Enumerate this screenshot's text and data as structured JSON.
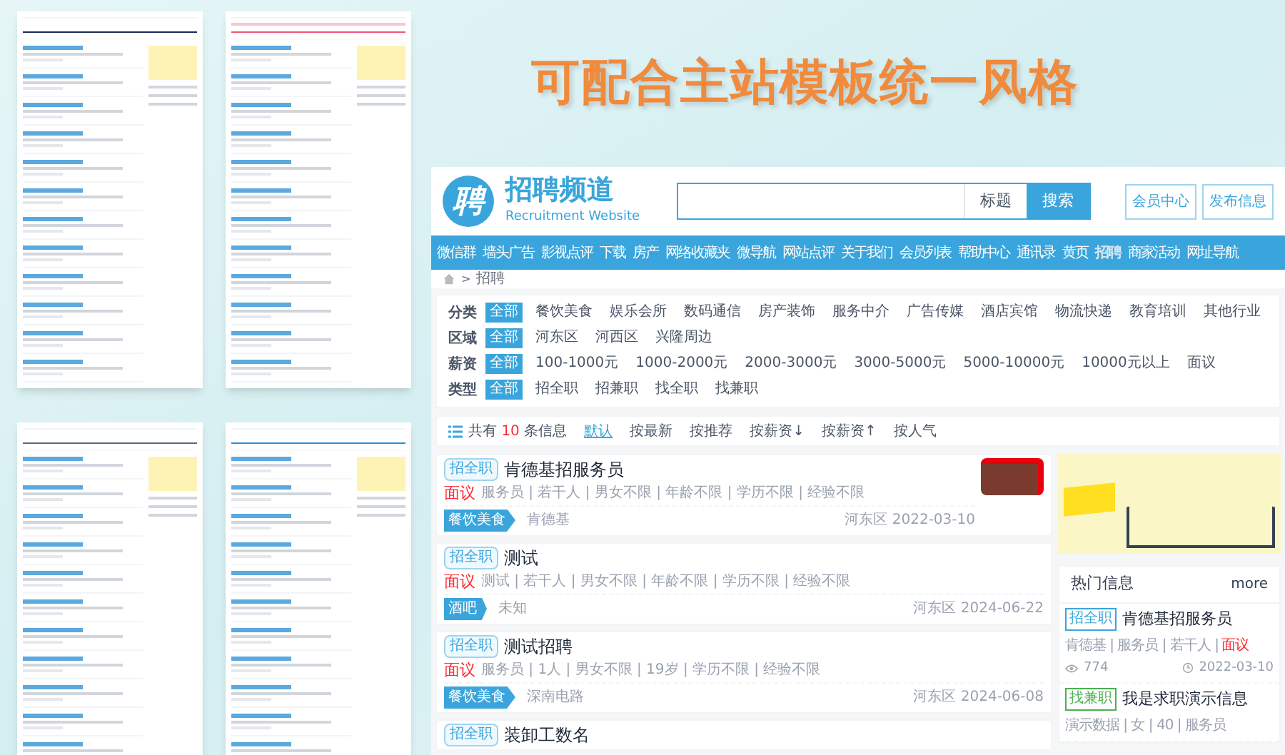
{
  "headline": "可配合主站模板统一风格",
  "site": {
    "logo_char": "聘",
    "title": "招聘频道",
    "subtitle": "Recruitment Website",
    "search": {
      "scope": "标题",
      "button": "搜索"
    },
    "header_buttons": [
      "会员中心",
      "发布信息"
    ]
  },
  "nav": [
    {
      "label": "微信群",
      "selected": false
    },
    {
      "label": "墙头广告",
      "selected": false
    },
    {
      "label": "影视点评",
      "selected": false
    },
    {
      "label": "下载",
      "selected": false
    },
    {
      "label": "房产",
      "selected": false
    },
    {
      "label": "网络收藏夹",
      "selected": false
    },
    {
      "label": "微导航",
      "selected": false
    },
    {
      "label": "网站点评",
      "selected": false
    },
    {
      "label": "关于我们",
      "selected": false
    },
    {
      "label": "会员列表",
      "selected": false
    },
    {
      "label": "帮助中心",
      "selected": false
    },
    {
      "label": "通讯录",
      "selected": false
    },
    {
      "label": "黄页",
      "selected": false
    },
    {
      "label": "招聘",
      "selected": true
    },
    {
      "label": "商家活动",
      "selected": false
    },
    {
      "label": "网址导航",
      "selected": false
    }
  ],
  "breadcrumb": {
    "separator": ">",
    "current": "招聘"
  },
  "filters": [
    {
      "label": "分类",
      "options": [
        {
          "label": "全部",
          "selected": true
        },
        {
          "label": "餐饮美食",
          "selected": false
        },
        {
          "label": "娱乐会所",
          "selected": false
        },
        {
          "label": "数码通信",
          "selected": false
        },
        {
          "label": "房产装饰",
          "selected": false
        },
        {
          "label": "服务中介",
          "selected": false
        },
        {
          "label": "广告传媒",
          "selected": false
        },
        {
          "label": "酒店宾馆",
          "selected": false
        },
        {
          "label": "物流快递",
          "selected": false
        },
        {
          "label": "教育培训",
          "selected": false
        },
        {
          "label": "其他行业",
          "selected": false
        }
      ]
    },
    {
      "label": "区域",
      "options": [
        {
          "label": "全部",
          "selected": true
        },
        {
          "label": "河东区",
          "selected": false
        },
        {
          "label": "河西区",
          "selected": false
        },
        {
          "label": "兴隆周边",
          "selected": false
        }
      ]
    },
    {
      "label": "薪资",
      "options": [
        {
          "label": "全部",
          "selected": true
        },
        {
          "label": "100-1000元",
          "selected": false
        },
        {
          "label": "1000-2000元",
          "selected": false
        },
        {
          "label": "2000-3000元",
          "selected": false
        },
        {
          "label": "3000-5000元",
          "selected": false
        },
        {
          "label": "5000-10000元",
          "selected": false
        },
        {
          "label": "10000元以上",
          "selected": false
        },
        {
          "label": "面议",
          "selected": false
        }
      ]
    },
    {
      "label": "类型",
      "options": [
        {
          "label": "全部",
          "selected": true
        },
        {
          "label": "招全职",
          "selected": false
        },
        {
          "label": "招兼职",
          "selected": false
        },
        {
          "label": "找全职",
          "selected": false
        },
        {
          "label": "找兼职",
          "selected": false
        }
      ]
    }
  ],
  "summary": {
    "prefix": "共有",
    "count": "10",
    "suffix": "条信息"
  },
  "sorts": [
    {
      "label": "默认",
      "selected": true
    },
    {
      "label": "按最新",
      "selected": false
    },
    {
      "label": "按推荐",
      "selected": false
    },
    {
      "label": "按薪资↓",
      "selected": false
    },
    {
      "label": "按薪资↑",
      "selected": false
    },
    {
      "label": "按人气",
      "selected": false
    }
  ],
  "listings": [
    {
      "type": "招全职",
      "title": "肯德基招服务员",
      "salary": "面议",
      "details": "服务员 | 若干人 | 男女不限 | 年龄不限 | 学历不限 | 经验不限",
      "tag": "餐饮美食",
      "company": "肯德基",
      "area": "河东区",
      "date": "2022-03-10",
      "has_photo": true
    },
    {
      "type": "招全职",
      "title": "测试",
      "salary": "面议",
      "details": "测试 | 若干人 | 男女不限 | 年龄不限 | 学历不限 | 经验不限",
      "tag": "酒吧",
      "company": "未知",
      "area": "河东区",
      "date": "2024-06-22",
      "has_photo": false
    },
    {
      "type": "招全职",
      "title": "测试招聘",
      "salary": "面议",
      "details": "服务员 | 1人 | 男女不限 | 19岁 | 学历不限 | 经验不限",
      "tag": "餐饮美食",
      "company": "深南电路",
      "area": "河东区",
      "date": "2024-06-08",
      "has_photo": false
    },
    {
      "type": "招全职",
      "title": "装卸工数名",
      "has_photo": false
    }
  ],
  "hot": {
    "title": "热门信息",
    "more": "more",
    "items": [
      {
        "badge": "招全职",
        "color": "#3aa5dc",
        "title": "肯德基招服务员",
        "meta": "肯德基 | 服务员 | 若干人 |",
        "salary": "面议",
        "views": "774",
        "date": "2022-03-10"
      },
      {
        "badge": "找兼职",
        "color": "#4caf50",
        "title": "我是求职演示信息",
        "meta": "演示数据 | 女 | 40 | 服务员"
      }
    ]
  }
}
